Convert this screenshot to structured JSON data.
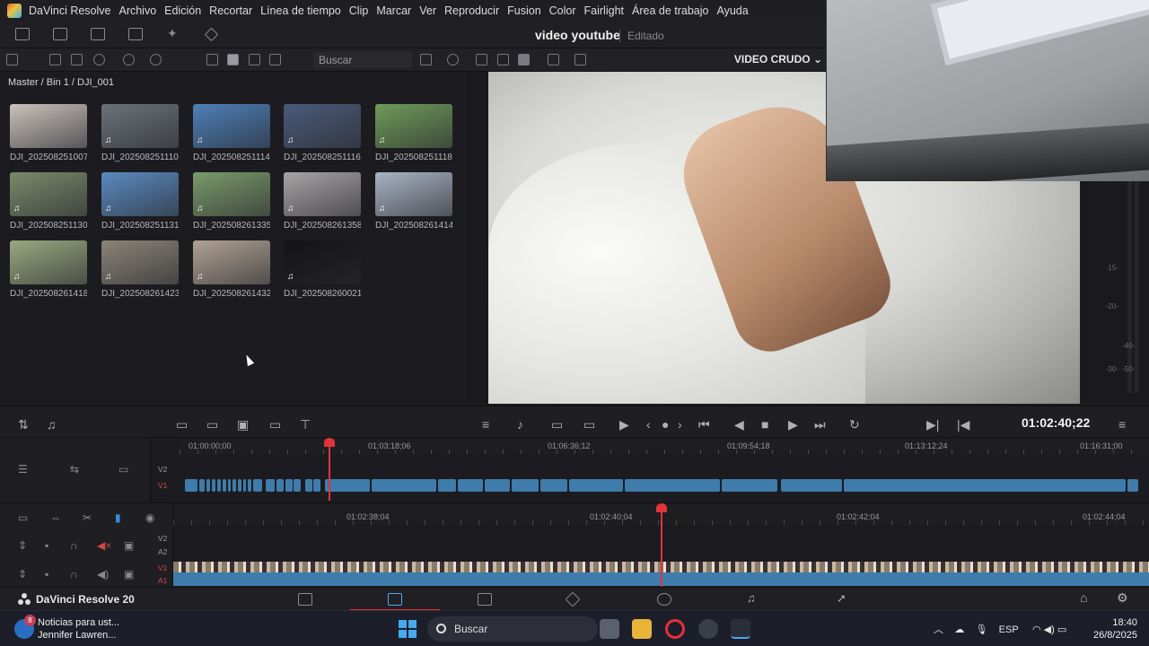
{
  "menu": {
    "app": "DaVinci Resolve",
    "items": [
      "Archivo",
      "Edición",
      "Recortar",
      "Línea de tiempo",
      "Clip",
      "Marcar",
      "Ver",
      "Reproducir",
      "Fusion",
      "Color",
      "Fairlight",
      "Área de trabajo",
      "Ayuda"
    ]
  },
  "project": {
    "title": "video youtube",
    "state": "Editado"
  },
  "media_pool": {
    "search_placeholder": "Buscar",
    "breadcrumb": "Master / Bin 1 / DJI_001",
    "clips": [
      {
        "name": "DJI_202508251007...",
        "color": "#c9c2bd"
      },
      {
        "name": "DJI_202508251110...",
        "color": "#6b7378"
      },
      {
        "name": "DJI_202508251114...",
        "color": "#4d7fb8"
      },
      {
        "name": "DJI_202508251116...",
        "color": "#4a5a7a"
      },
      {
        "name": "DJI_202508251118...",
        "color": "#6f9a5a"
      },
      {
        "name": "DJI_202508251130...",
        "color": "#7a8a6a"
      },
      {
        "name": "DJI_202508251131...",
        "color": "#5a8ac0"
      },
      {
        "name": "DJI_202508261335...",
        "color": "#7a9a6a"
      },
      {
        "name": "DJI_202508261358...",
        "color": "#a8a4a6"
      },
      {
        "name": "DJI_202508261414...",
        "color": "#a8b4c4"
      },
      {
        "name": "DJI_202508261418...",
        "color": "#9aa880"
      },
      {
        "name": "DJI_202508261423...",
        "color": "#8a8478"
      },
      {
        "name": "DJI_202508261432...",
        "color": "#b0a294"
      },
      {
        "name": "DJI_202508260021...",
        "color": "#141418"
      }
    ]
  },
  "viewer": {
    "label": "VIDEO CRUDO",
    "meter_ticks": [
      "-15-",
      "-20-",
      "-30-",
      "-40-",
      "-50-"
    ],
    "timecode": "01:02:40;22"
  },
  "timeline_overview": {
    "ruler": [
      "01:00:00;00",
      "01:03:18;06",
      "01:06:36;12",
      "01:09:54;18",
      "01:13:12;24",
      "01:16:31;00"
    ],
    "tracks": [
      "V2",
      "V1"
    ]
  },
  "timeline_detail": {
    "ruler": [
      "01:02:38;04",
      "01:02:40;04",
      "01:02:42;04",
      "01:02:44;04"
    ],
    "tracks": [
      "V2",
      "A2",
      "V1",
      "A1"
    ]
  },
  "page_bar": {
    "brand": "DaVinci Resolve 20"
  },
  "taskbar": {
    "news_title": "Noticias para ust...",
    "news_sub": "Jennifer Lawren...",
    "news_badge": "8",
    "search": "Buscar",
    "lang": "ESP",
    "time": "18:40",
    "date": "26/8/2025"
  }
}
